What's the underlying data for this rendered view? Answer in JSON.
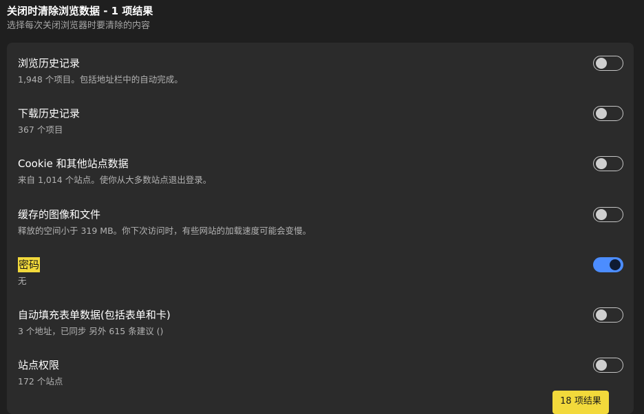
{
  "header": {
    "title": "关闭时清除浏览数据 - 1 项结果",
    "subtitle": "选择每次关闭浏览器时要清除的内容"
  },
  "items": [
    {
      "label": "浏览历史记录",
      "desc": "1,948 个项目。包括地址栏中的自动完成。",
      "enabled": false
    },
    {
      "label": "下载历史记录",
      "desc": "367 个项目",
      "enabled": false
    },
    {
      "label": "Cookie 和其他站点数据",
      "desc": "来自 1,014 个站点。使你从大多数站点退出登录。",
      "enabled": false
    },
    {
      "label": "缓存的图像和文件",
      "desc": "释放的空间小于 319 MB。你下次访问时，有些网站的加载速度可能会变慢。",
      "enabled": false
    },
    {
      "label": "密码",
      "desc": "无",
      "enabled": true,
      "highlighted": true
    },
    {
      "label": "自动填充表单数据(包括表单和卡)",
      "desc": "3 个地址，已同步 另外 615 条建议 ()",
      "enabled": false
    },
    {
      "label": "站点权限",
      "desc": "172 个站点",
      "enabled": false
    }
  ],
  "results_badge": "18 项结果",
  "colors": {
    "toggle_on": "#4c8dff",
    "highlight": "#f2d93b"
  }
}
